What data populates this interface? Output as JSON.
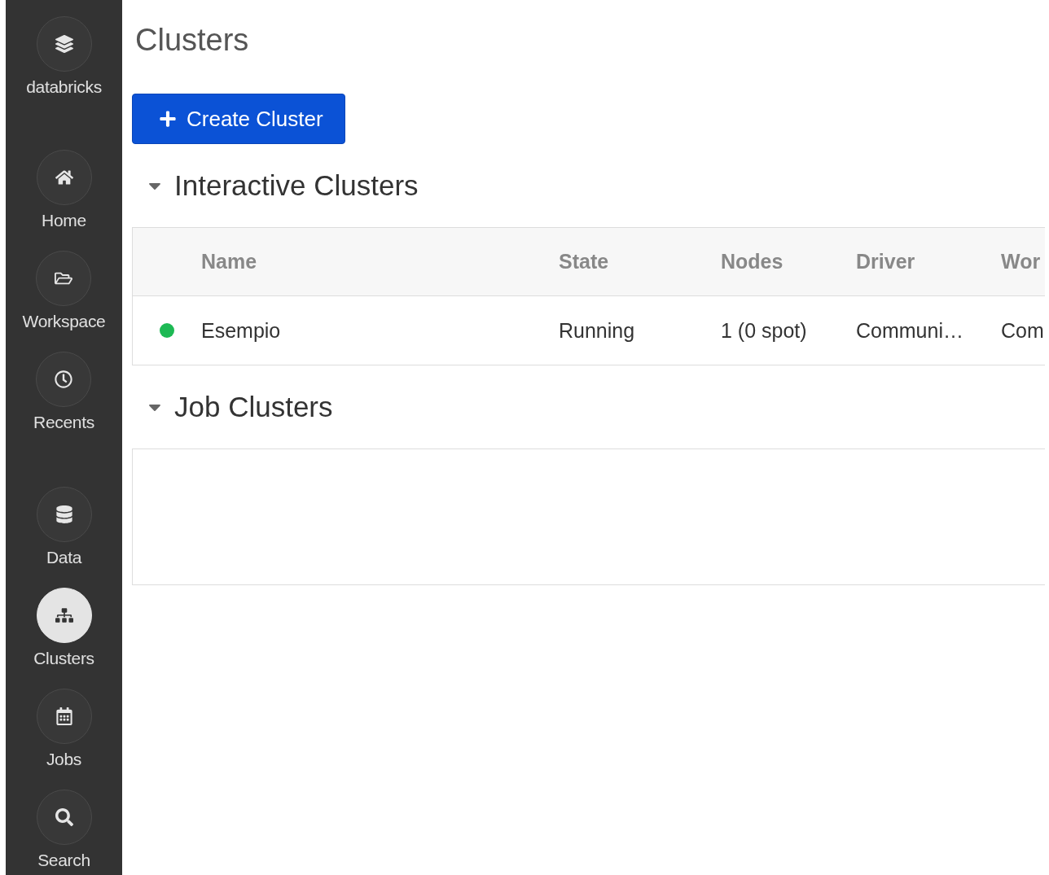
{
  "sidebar": {
    "brand": "databricks",
    "items": [
      {
        "label": "Home",
        "selected": false
      },
      {
        "label": "Workspace",
        "selected": false
      },
      {
        "label": "Recents",
        "selected": false
      },
      {
        "label": "Data",
        "selected": false
      },
      {
        "label": "Clusters",
        "selected": true
      },
      {
        "label": "Jobs",
        "selected": false
      },
      {
        "label": "Search",
        "selected": false
      }
    ]
  },
  "page": {
    "title": "Clusters",
    "create_button": "Create Cluster"
  },
  "sections": [
    {
      "title": "Interactive Clusters",
      "expanded": true,
      "columns": [
        "Name",
        "State",
        "Nodes",
        "Driver",
        "Wor"
      ],
      "rows": [
        {
          "color": "#1db954",
          "cells": [
            "Esempio",
            "Running",
            "1 (0 spot)",
            "Communi…",
            "Com"
          ]
        }
      ]
    },
    {
      "title": "Job Clusters",
      "expanded": true
    }
  ]
}
